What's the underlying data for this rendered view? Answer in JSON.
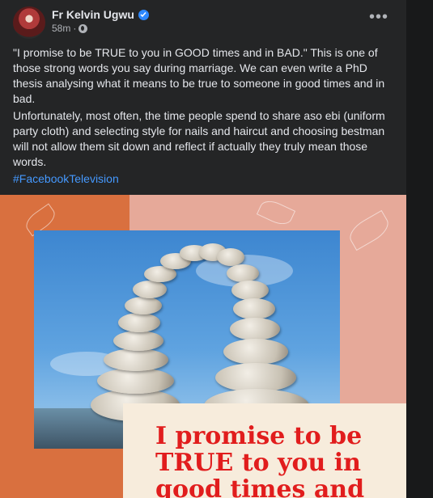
{
  "post": {
    "author": "Fr Kelvin Ugwu",
    "time": "58m",
    "more_label": "•••",
    "paragraph1": "\"I promise to be TRUE to you in GOOD times and in BAD.\" This is one of those strong words you say during marriage. We can even write a PhD thesis analysing what it means to be true to someone in good times and in bad.",
    "paragraph2": "Unfortunately, most often, the time people spend to share aso ebi (uniform party cloth) and selecting style for nails and haircut and choosing bestman will not allow them sit down and reflect if actually they truly mean those words.",
    "hashtag": "#FacebookTelevision"
  },
  "image": {
    "line1": "I promise to be",
    "line2": "TRUE to you in",
    "line3": "good times and"
  },
  "icons": {
    "verified": "verified-badge-icon",
    "privacy": "globe-icon",
    "more": "more-options-icon"
  },
  "colors": {
    "background": "#242526",
    "text": "#e4e6eb",
    "link": "#4599ff",
    "quote": "#e11d1d"
  }
}
